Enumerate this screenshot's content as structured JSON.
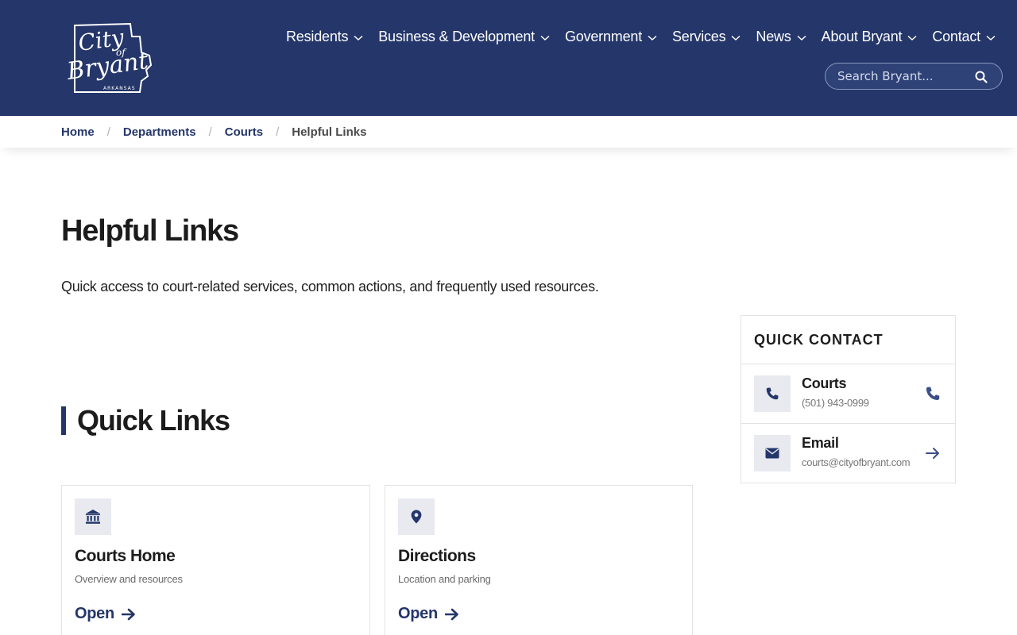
{
  "site": {
    "logo_text": "City of Bryant",
    "logo_subtext": "ARKANSAS"
  },
  "nav": {
    "items": [
      {
        "label": "Residents"
      },
      {
        "label": "Business & Development"
      },
      {
        "label": "Government"
      },
      {
        "label": "Services"
      },
      {
        "label": "News"
      },
      {
        "label": "About Bryant"
      },
      {
        "label": "Contact"
      }
    ]
  },
  "search": {
    "placeholder": "Search Bryant..."
  },
  "breadcrumb": {
    "items": [
      "Home",
      "Departments",
      "Courts",
      "Helpful Links"
    ],
    "separator": "/"
  },
  "page": {
    "title": "Helpful Links",
    "intro": "Quick access to court-related services, common actions, and frequently used resources."
  },
  "quick_links": {
    "heading": "Quick Links",
    "cards": [
      {
        "icon": "bank-icon",
        "title": "Courts Home",
        "description": "Overview and resources",
        "link_label": "Open"
      },
      {
        "icon": "map-pin-icon",
        "title": "Directions",
        "description": "Location and parking",
        "link_label": "Open"
      }
    ]
  },
  "quick_contact": {
    "title": "QUICK CONTACT",
    "rows": [
      {
        "icon": "phone-icon",
        "label": "Courts",
        "value": "(501) 943-0999",
        "action_icon": "phone-icon"
      },
      {
        "icon": "envelope-icon",
        "label": "Email",
        "value": "courts@cityofbryant.com",
        "action_icon": "arrow-right-icon"
      }
    ]
  },
  "colors": {
    "brand": "#24366a",
    "icon_bg": "#e8eaf0",
    "border": "#e3e3e3"
  }
}
